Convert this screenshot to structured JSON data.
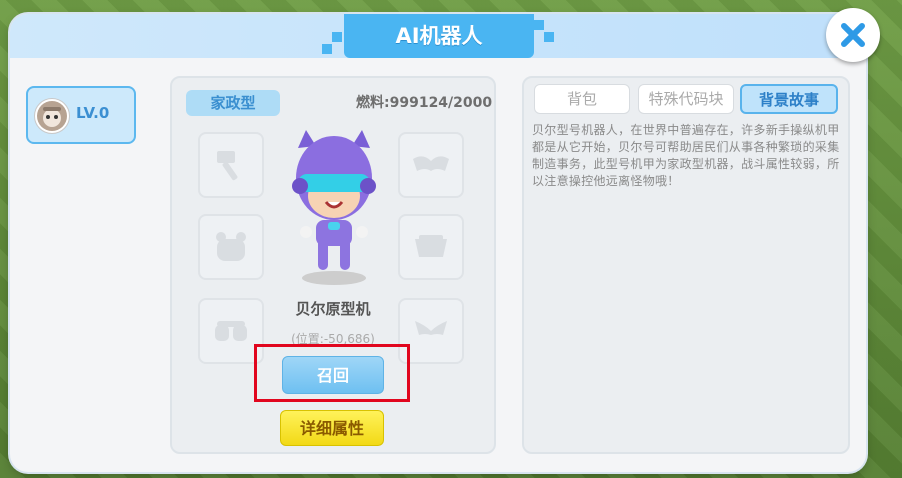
{
  "window": {
    "title": "AI机器人"
  },
  "level": {
    "label": "LV.0"
  },
  "robot": {
    "type_tag": "家政型",
    "fuel_text": "燃料:999124/2000",
    "name": "贝尔原型机",
    "position_text": "(位置:-50,686)"
  },
  "buttons": {
    "recall": "召回",
    "details": "详细属性"
  },
  "tabs": [
    {
      "label": "背包"
    },
    {
      "label": "特殊代码块"
    },
    {
      "label": "背景故事",
      "active": true
    }
  ],
  "story": {
    "text": "贝尔型号机器人，在世界中普遍存在，许多新手操纵机甲都是从它开始，贝尔号可帮助居民们从事各种繁琐的采集制造事务，此型号机甲为家政型机器，战斗属性较弱，所以注意操控他远离怪物哦！"
  },
  "equipment_slots": [
    {
      "icon": "hammer-icon"
    },
    {
      "icon": "wings-icon"
    },
    {
      "icon": "helmet-icon"
    },
    {
      "icon": "armor-icon"
    },
    {
      "icon": "boots-icon"
    },
    {
      "icon": "bow-icon"
    }
  ],
  "colors": {
    "accent": "#4ab5f2",
    "highlight": "#e1061e",
    "detail_button": "#f2d916"
  }
}
